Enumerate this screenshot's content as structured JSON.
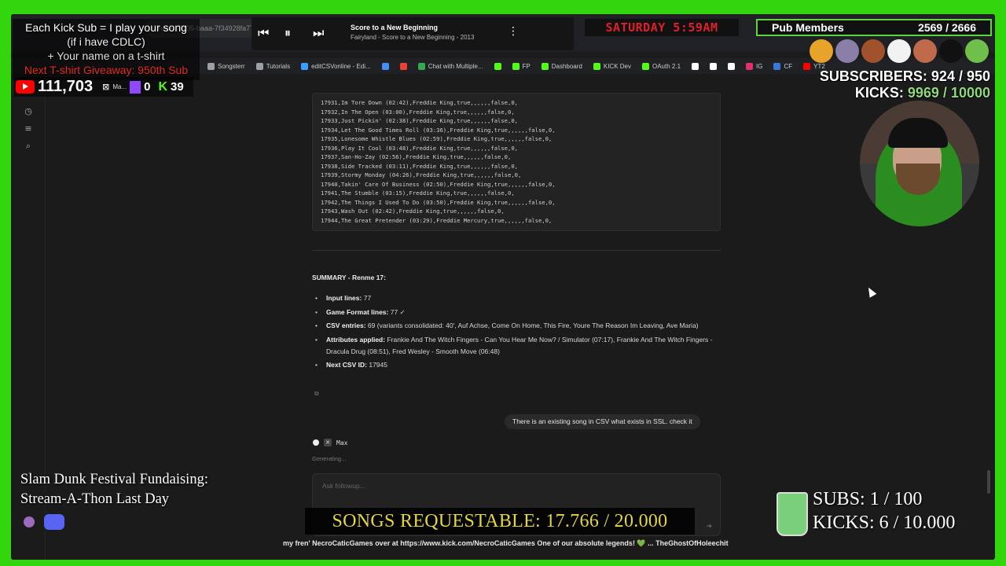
{
  "browser": {
    "url": "...nera/ /7105-baaa-7f34928fa779",
    "bookmarks": [
      {
        "label": "Songsterr",
        "color": "#9aa0a6"
      },
      {
        "label": "Tutorials",
        "color": "#9aa0a6"
      },
      {
        "label": "editCSVonline - Edi...",
        "color": "#3aa0ff"
      },
      {
        "label": "",
        "color": "#4a8df0"
      },
      {
        "label": "",
        "color": "#ea4335"
      },
      {
        "label": "Chat with Multiple...",
        "color": "#34a853"
      },
      {
        "label": "",
        "color": "#53fc18"
      },
      {
        "label": "FP",
        "color": "#53fc18"
      },
      {
        "label": "Dashboard",
        "color": "#53fc18"
      },
      {
        "label": "KICK Dev",
        "color": "#53fc18"
      },
      {
        "label": "OAuth 2.1",
        "color": "#53fc18"
      },
      {
        "label": "",
        "color": "#ffffff"
      },
      {
        "label": "",
        "color": "#ffffff"
      },
      {
        "label": "",
        "color": "#ffffff"
      },
      {
        "label": "IG",
        "color": "#e1306c"
      },
      {
        "label": "CF",
        "color": "#3a78d8"
      },
      {
        "label": "YT2",
        "color": "#ff0000"
      }
    ]
  },
  "code_lines": [
    "17931,Im Tore Down (02:42),Freddie King,true,,,,,,false,0,",
    "17932,In The Open (03:00),Freddie King,true,,,,,,false,0,",
    "17933,Just Pickin' (02:38),Freddie King,true,,,,,,false,0,",
    "17934,Let The Good Times Roll (03:36),Freddie King,true,,,,,,false,0,",
    "17935,Lonesome Whistle Blues (02:59),Freddie King,true,,,,,,false,0,",
    "17936,Play It Cool (03:48),Freddie King,true,,,,,,false,0,",
    "17937,San-Ho-Zay (02:56),Freddie King,true,,,,,,false,0,",
    "17938,Side Tracked (03:11),Freddie King,true,,,,,,false,0,",
    "17939,Stormy Monday (04:26),Freddie King,true,,,,,,false,0,",
    "17940,Takin' Care Of Business (02:50),Freddie King,true,,,,,,false,0,",
    "17941,The Stumble (03:15),Freddie King,true,,,,,,false,0,",
    "17942,The Things I Used To Do (03:50),Freddie King,true,,,,,,false,0,",
    "17943,Wash Out (02:42),Freddie King,true,,,,,,false,0,",
    "17944,The Great Pretender (03:29),Freddie Mercury,true,,,,,,false,0,"
  ],
  "summary": {
    "title": "SUMMARY - Renme 17:",
    "items": [
      {
        "label": "Input lines:",
        "value": "77"
      },
      {
        "label": "Game Format lines:",
        "value": "77 ✓"
      },
      {
        "label": "CSV entries:",
        "value": "69 (variants consolidated: 40', Auf Achse, Come On Home, This Fire, Youre The Reason Im Leaving, Ave Maria)"
      },
      {
        "label": "Attributes applied:",
        "value": "Frankie And The Witch Fingers - Can You Hear Me Now? / Simulator (07:17), Frankie And The Witch Fingers - Dracula Drug (08:51), Fred Wesley - Smooth Move (06:48)"
      },
      {
        "label": "Next CSV ID:",
        "value": "17945"
      }
    ]
  },
  "user_message": "There is an existing song in CSV what exists in SSL. check it",
  "model": {
    "name": "Max",
    "status": "Generating..."
  },
  "followup": {
    "placeholder": "Ask followup..."
  },
  "overlay": {
    "kick_sub": [
      "Each Kick Sub = I play your song",
      "(if i have CDLC)",
      "+ Your name on a t-shirt",
      "Next T-shirt Giveaway: 950th Sub"
    ],
    "youtube_count": "111,703",
    "twitch_label": "Ma...",
    "twitch_count": "0",
    "kick_count": "39",
    "player": {
      "title": "Score to a New Beginning",
      "subtitle": "Fairyland - Score to a New Beginning - 2013"
    },
    "clock": "SATURDAY 5:59AM",
    "pub_members_label": "Pub Members",
    "pub_members_count": "2569 / 2666",
    "subscribers_label": "SUBSCRIBERS:",
    "subscribers_value": "924 / 950",
    "kicks_label": "KICKS:",
    "kicks_value": "9969 / 10000",
    "fundraising": [
      "Slam Dunk Festival Fundaising:",
      "Stream-A-Thon Last Day"
    ],
    "songs_requestable": "SONGS REQUESTABLE: 17.766 / 20.000",
    "ticker": "my fren' NecroCaticGames over at https://www.kick.com/NecroCaticGames One of our absolute legends! 💚 ... TheGhostOfHoleechit",
    "subs_count": "SUBS:  1 / 100",
    "kicks_count": "KICKS: 6 / 10.000"
  },
  "colors": {
    "green_frame": "#33d50d",
    "kick_green": "#53fc18",
    "youtube_red": "#ff0000",
    "twitch_purple": "#9147ff",
    "banner_yellow": "#e3d640"
  }
}
